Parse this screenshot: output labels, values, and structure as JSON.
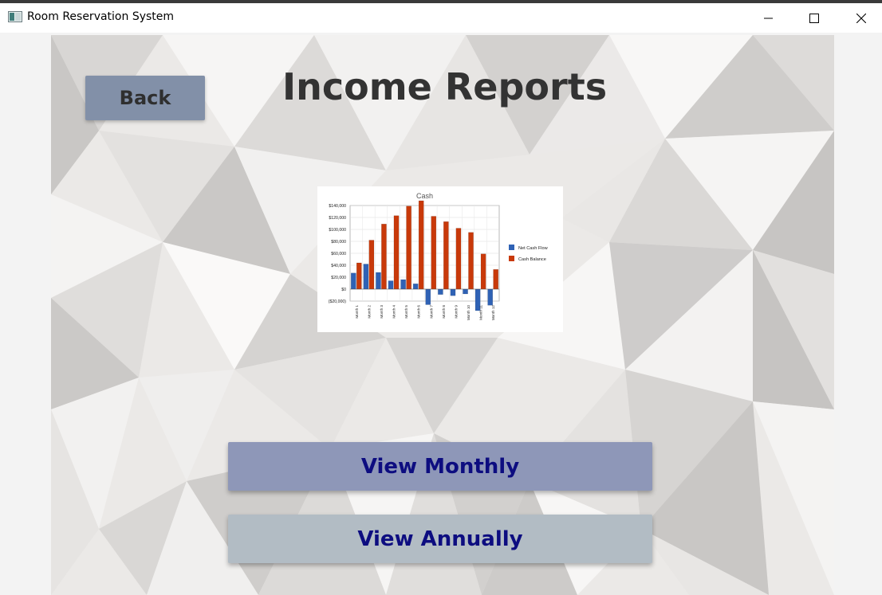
{
  "window": {
    "title": "Room Reservation System",
    "icons": [
      "app-icon",
      "minimize-icon",
      "maximize-icon",
      "close-icon"
    ]
  },
  "page": {
    "back_label": "Back",
    "title": "Income Reports",
    "monthly_label": "View Monthly",
    "annually_label": "View Annually"
  },
  "chart_data": {
    "type": "bar",
    "title": "Cash",
    "xlabel": "",
    "ylabel": "",
    "ylim": [
      -20000,
      140000
    ],
    "yticks": [
      "($20,000)",
      "$0",
      "$20,000",
      "$40,000",
      "$60,000",
      "$80,000",
      "$100,000",
      "$120,000",
      "$140,000"
    ],
    "grid": true,
    "legend": "right",
    "categories": [
      "Month 1",
      "Month 2",
      "Month 3",
      "Month 4",
      "Month 5",
      "Month 6",
      "Month 7",
      "Month 8",
      "Month 9",
      "Month 10",
      "Month 11",
      "Month 12"
    ],
    "series": [
      {
        "name": "Net Cash Flow",
        "color": "#2f62b5",
        "values": [
          27000,
          42000,
          28000,
          14000,
          16000,
          9000,
          -26000,
          -9000,
          -11000,
          -8000,
          -36000,
          -27000
        ]
      },
      {
        "name": "Cash Balance",
        "color": "#c8390a",
        "values": [
          44000,
          82000,
          109000,
          123000,
          139000,
          148000,
          122000,
          113000,
          102000,
          95000,
          59000,
          33000
        ]
      }
    ]
  }
}
